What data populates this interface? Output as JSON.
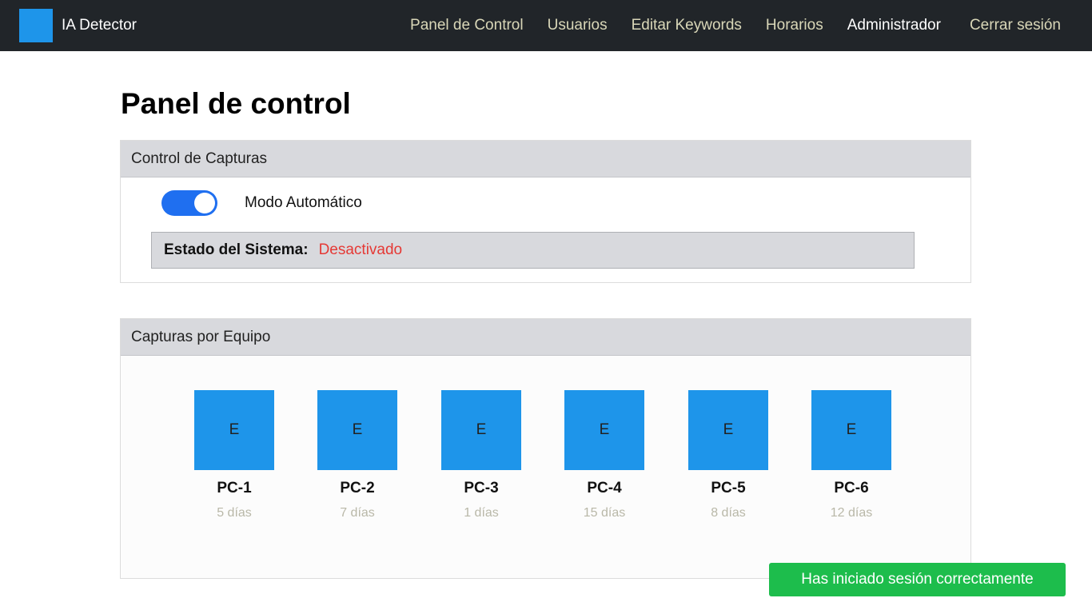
{
  "brand": {
    "name": "IA Detector",
    "logo_color": "#1e95ea"
  },
  "nav": {
    "panel": "Panel de Control",
    "users": "Usuarios",
    "keywords": "Editar Keywords",
    "schedules": "Horarios",
    "admin": "Administrador",
    "logout": "Cerrar sesión"
  },
  "page_title": "Panel de control",
  "capture_control": {
    "header": "Control de Capturas",
    "toggle_label": "Modo Automático",
    "toggle_on": true,
    "status_label": "Estado del Sistema:",
    "status_value": "Desactivado",
    "status_color": "#e53935"
  },
  "captures": {
    "header": "Capturas por Equipo",
    "items": [
      {
        "thumb": "E",
        "name": "PC-1",
        "age": "5 días"
      },
      {
        "thumb": "E",
        "name": "PC-2",
        "age": "7 días"
      },
      {
        "thumb": "E",
        "name": "PC-3",
        "age": "1 días"
      },
      {
        "thumb": "E",
        "name": "PC-4",
        "age": "15 días"
      },
      {
        "thumb": "E",
        "name": "PC-5",
        "age": "8 días"
      },
      {
        "thumb": "E",
        "name": "PC-6",
        "age": "12 días"
      }
    ]
  },
  "toast": {
    "message": "Has iniciado sesión correctamente",
    "color": "#1dbd4c"
  }
}
